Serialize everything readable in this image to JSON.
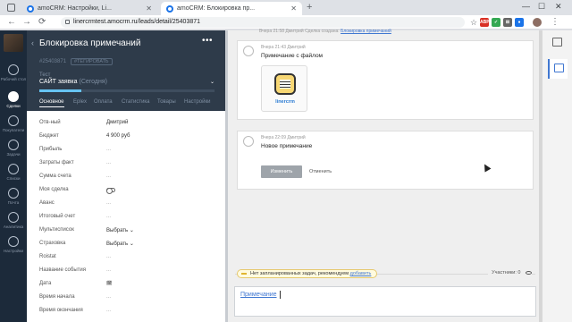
{
  "browser": {
    "tabs": [
      {
        "label": "amoCRM: Настройки, Li..."
      },
      {
        "label": "amoCRM: Блокировка пр..."
      }
    ],
    "new_tab": "+",
    "url": "linercrmtest.amocrm.ru/leads/detail/25403871",
    "window_controls": [
      "—",
      "☐",
      "✕"
    ]
  },
  "leftnav": {
    "items": [
      {
        "label": "Рабочий стол",
        "icon": "speedometer-icon"
      },
      {
        "label": "Сделки",
        "icon": "deals-icon",
        "active": true
      },
      {
        "label": "Покупатели",
        "icon": "customers-icon"
      },
      {
        "label": "Задачи",
        "icon": "tasks-icon"
      },
      {
        "label": "Списки",
        "icon": "lists-icon"
      },
      {
        "label": "Почта",
        "icon": "mail-icon"
      },
      {
        "label": "Аналитика",
        "icon": "analytics-icon"
      },
      {
        "label": "Настройки",
        "icon": "settings-icon"
      }
    ]
  },
  "lead": {
    "title": "Блокировка примечаний",
    "menu": "•••",
    "id": "#25403871",
    "tag": "#ТЕГИРОВАТЬ",
    "pipeline_label": "Тест",
    "stage": "САЙТ заявка",
    "stage_sub": "(Сегодня)",
    "stage_progress": 0.24,
    "tabs": [
      "Основное",
      "Eplex",
      "Оплата",
      "Статистика",
      "Товары",
      "Настройки"
    ],
    "fields": [
      {
        "label": "Отв-ный",
        "value": "Дмитрий"
      },
      {
        "label": "Бюджет",
        "value": "4 900 руб"
      },
      {
        "label": "Прибыль",
        "value": "..."
      },
      {
        "label": "Затраты факт",
        "value": "..."
      },
      {
        "label": "Сумма счета",
        "value": "..."
      },
      {
        "label": "Моя сделка",
        "value": ""
      },
      {
        "label": "Аванс",
        "value": "..."
      },
      {
        "label": "Итоговый счет",
        "value": "..."
      },
      {
        "label": "Мультисписок",
        "value": "Выбрать ⌄"
      },
      {
        "label": "Страховка",
        "value": "Выбрать ⌄"
      },
      {
        "label": "Roistat",
        "value": "..."
      },
      {
        "label": "Название события",
        "value": "..."
      },
      {
        "label": "Дата",
        "value": "🗓"
      },
      {
        "label": "Время начала",
        "value": "..."
      },
      {
        "label": "Время окончания",
        "value": "..."
      }
    ]
  },
  "feed": {
    "top_line_meta": "Вчера 21:58 Дмитрий  Сделка создана:",
    "top_line_link": "Блокировка примечаний",
    "notes": [
      {
        "meta": "Вчера 21:43 Дмитрий",
        "text": "Примечание с файлом",
        "file_name": "linercrm"
      },
      {
        "meta": "Вчера 22:09 Дмитрий",
        "text": "Новое примечание",
        "save": "Изменить",
        "cancel": "Отменить"
      }
    ],
    "task_msg": "Нет запланированных задач, рекомендуем",
    "task_link": "добавить",
    "participants": "Участники: 0",
    "composer_kind": "Примечание"
  }
}
